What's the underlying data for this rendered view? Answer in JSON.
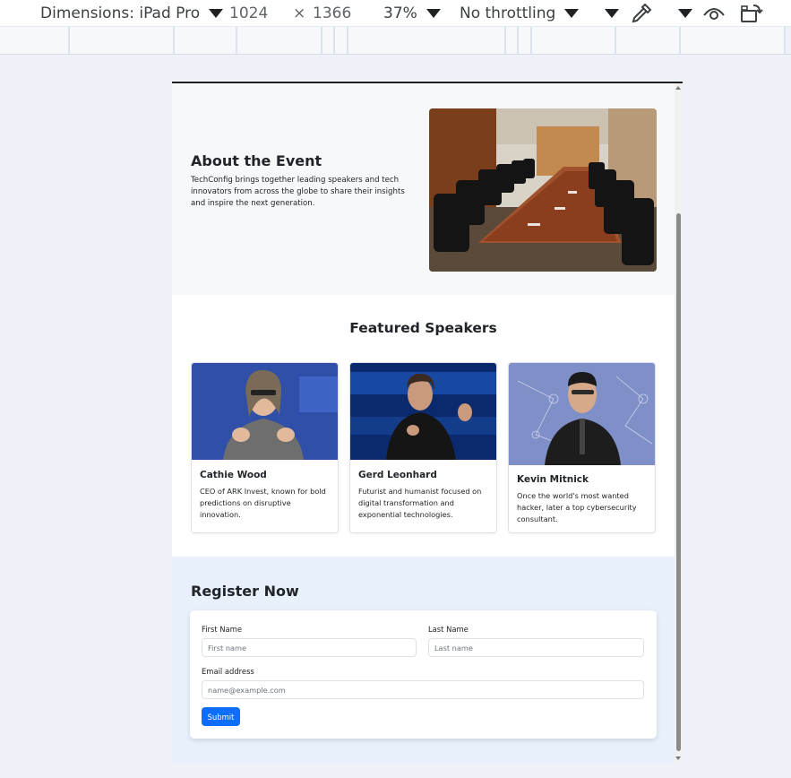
{
  "devtools": {
    "dimensions_label": "Dimensions: iPad Pro",
    "width": "1024",
    "times": "×",
    "height": "1366",
    "zoom": "37%",
    "throttling": "No throttling"
  },
  "about": {
    "title": "About the Event",
    "text": "TechConfig brings together leading speakers and tech innovators from across the globe to share their insights and inspire the next generation."
  },
  "speakers": {
    "title": "Featured Speakers",
    "items": [
      {
        "name": "Cathie Wood",
        "bio": "CEO of ARK Invest, known for bold predictions on disruptive innovation."
      },
      {
        "name": "Gerd Leonhard",
        "bio": "Futurist and humanist focused on digital transformation and exponential technologies."
      },
      {
        "name": "Kevin Mitnick",
        "bio": "Once the world's most wanted hacker, later a top cybersecurity consultant."
      }
    ]
  },
  "register": {
    "title": "Register Now",
    "first_name_label": "First Name",
    "first_name_placeholder": "First name",
    "last_name_label": "Last Name",
    "last_name_placeholder": "Last name",
    "email_label": "Email address",
    "email_placeholder": "name@example.com",
    "submit_label": "Submit"
  },
  "icons": [
    "caret-down-icon",
    "eyedropper-icon",
    "eye-icon",
    "rotate-icon",
    "close-icon"
  ],
  "colors": {
    "primary": "#0d6efd",
    "register_bg": "#e8f0fc",
    "about_bg": "#f7f8fa"
  }
}
